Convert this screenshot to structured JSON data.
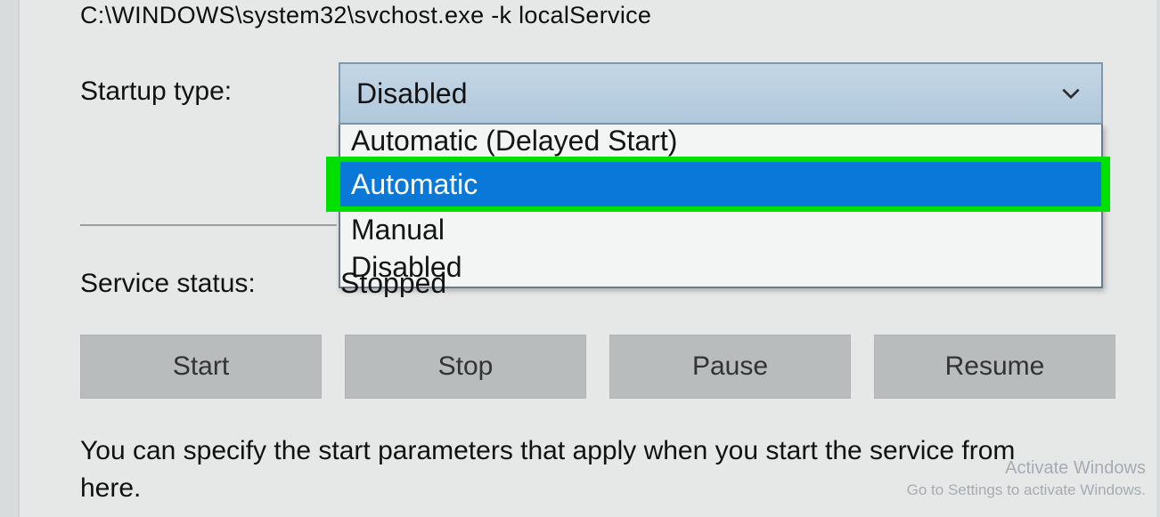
{
  "executable_path": "C:\\WINDOWS\\system32\\svchost.exe -k localService",
  "labels": {
    "startup_type": "Startup type:",
    "service_status": "Service status:"
  },
  "startup": {
    "selected": "Disabled",
    "options": {
      "delayed": "Automatic (Delayed Start)",
      "automatic": "Automatic",
      "manual": "Manual",
      "disabled": "Disabled"
    }
  },
  "status_value": "Stopped",
  "buttons": {
    "start": "Start",
    "stop": "Stop",
    "pause": "Pause",
    "resume": "Resume"
  },
  "help_text": "You can specify the start parameters that apply when you start the service from here.",
  "watermark": {
    "title": "Activate Windows",
    "sub": "Go to Settings to activate Windows."
  }
}
